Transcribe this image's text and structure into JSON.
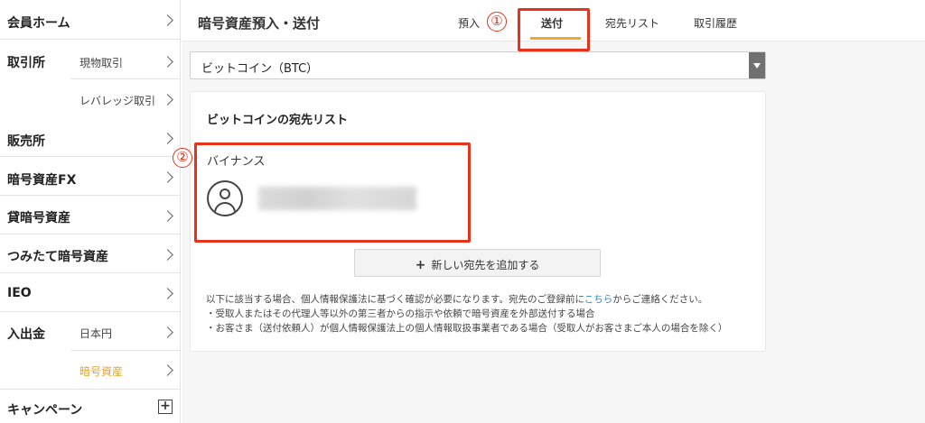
{
  "sidebar": {
    "member_home": "会員ホーム",
    "exchange": "取引所",
    "exchange_spot": "現物取引",
    "exchange_leverage": "レバレッジ取引",
    "shop": "販売所",
    "crypto_fx": "暗号資産FX",
    "lending": "貸暗号資産",
    "tsumitate": "つみたて暗号資産",
    "ieo": "IEO",
    "deposit_withdraw": "入出金",
    "dw_jpy": "日本円",
    "dw_crypto": "暗号資産",
    "campaign": "キャンペーン",
    "campaign_icon": "+"
  },
  "header": {
    "title": "暗号資産預入・送付",
    "tabs": [
      "預入",
      "送付",
      "宛先リスト",
      "取引履歴"
    ],
    "active_tab": "送付"
  },
  "annotations": {
    "one": "①",
    "two": "②"
  },
  "currency_select": {
    "value": "ビットコイン（BTC）"
  },
  "card": {
    "title": "ビットコインの宛先リスト",
    "contact_name": "バイナンス",
    "add_button_icon": "+",
    "add_button": "新しい宛先を追加する",
    "note_1_pre": "以下に該当する場合、個人情報保護法に基づく確認が必要になります。宛先のご登録前に",
    "note_1_link": "こちら",
    "note_1_post": "からご連絡ください。",
    "note_2": "・受取人またはその代理人等以外の第三者からの指示や依頼で暗号資産を外部送付する場合",
    "note_3": "・お客さま（送付依頼人）が個人情報保護法上の個人情報取扱事業者である場合（受取人がお客さまご本人の場合を除く）"
  },
  "colors": {
    "accent": "#f0a830",
    "highlight": "#e8321a",
    "link": "#2a8dc8"
  }
}
